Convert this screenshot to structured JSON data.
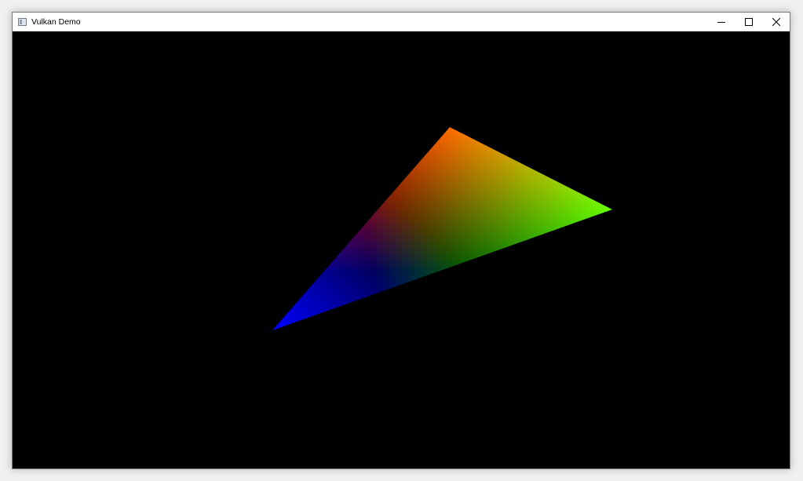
{
  "window": {
    "title": "Vulkan Demo",
    "icon": "application-window-icon",
    "controls": {
      "minimize_icon": "minimize-icon",
      "maximize_icon": "maximize-icon",
      "close_icon": "close-icon"
    }
  },
  "scene": {
    "background_color": "#000000",
    "triangle": {
      "vertex_colors": {
        "top": "#ff0000",
        "right": "#00ff00",
        "bottom_left": "#0000ff"
      }
    }
  }
}
